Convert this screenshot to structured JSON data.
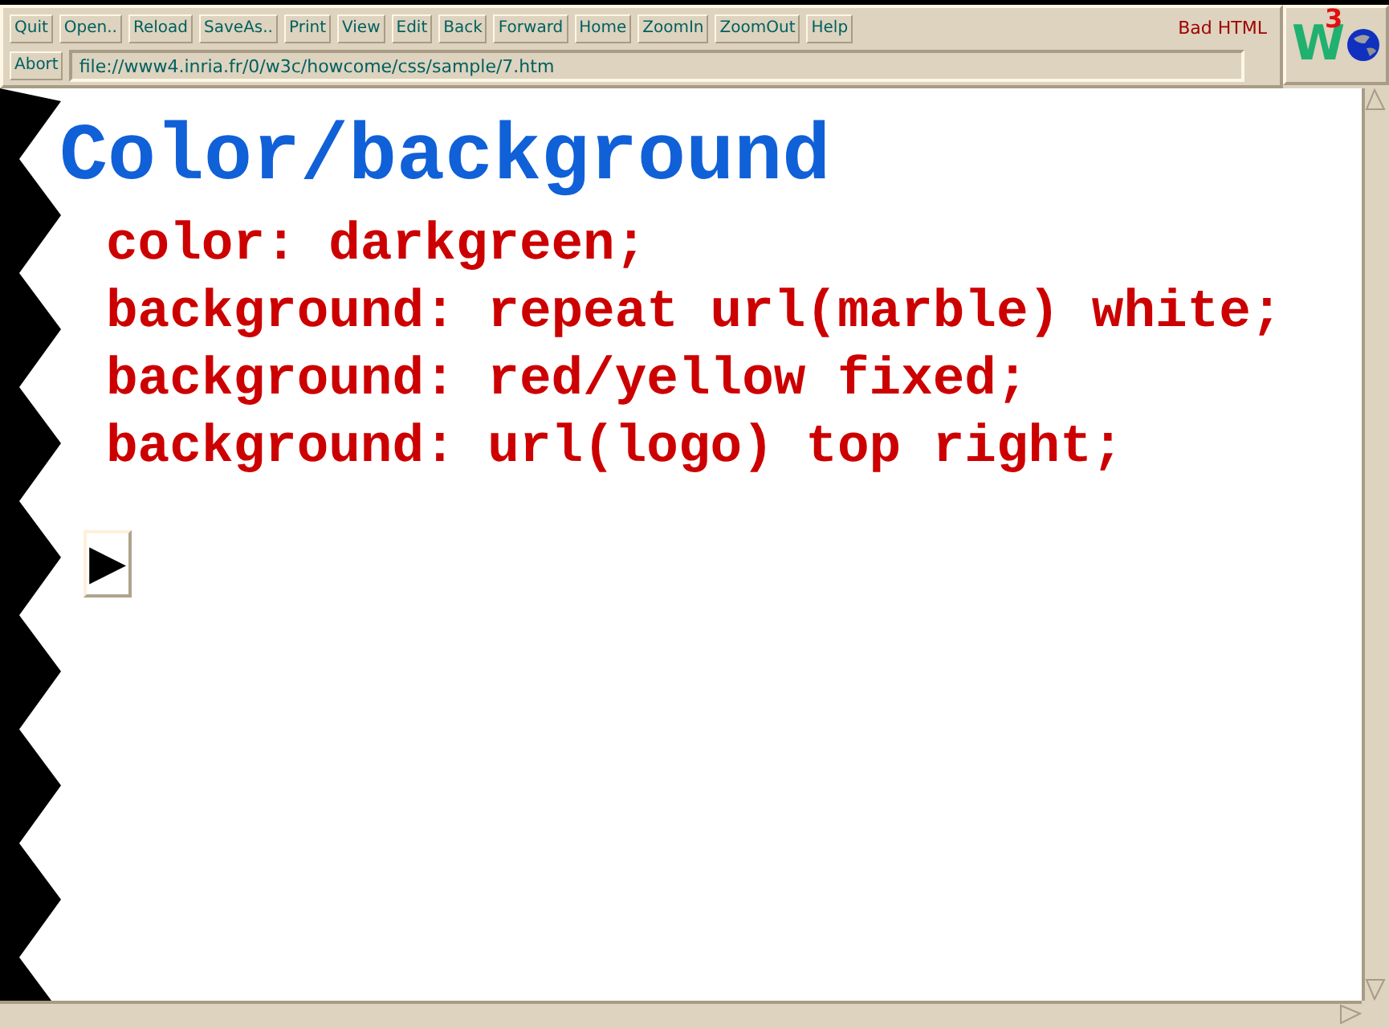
{
  "toolbar": {
    "buttons": [
      "Quit",
      "Open..",
      "Reload",
      "SaveAs..",
      "Print",
      "View",
      "Edit",
      "Back",
      "Forward",
      "Home",
      "ZoomIn",
      "ZoomOut",
      "Help"
    ],
    "status": "Bad HTML"
  },
  "address_bar": {
    "button": "Abort",
    "url": "file://www4.inria.fr/0/w3c/howcome/css/sample/7.htm"
  },
  "logo": {
    "letter": "W",
    "superscript": "3"
  },
  "document": {
    "heading": "Color/background",
    "lines": [
      "color: darkgreen;",
      "background: repeat url(marble) white;",
      "background: red/yellow fixed;",
      "background: url(logo) top right;"
    ],
    "next_button": "▶"
  }
}
